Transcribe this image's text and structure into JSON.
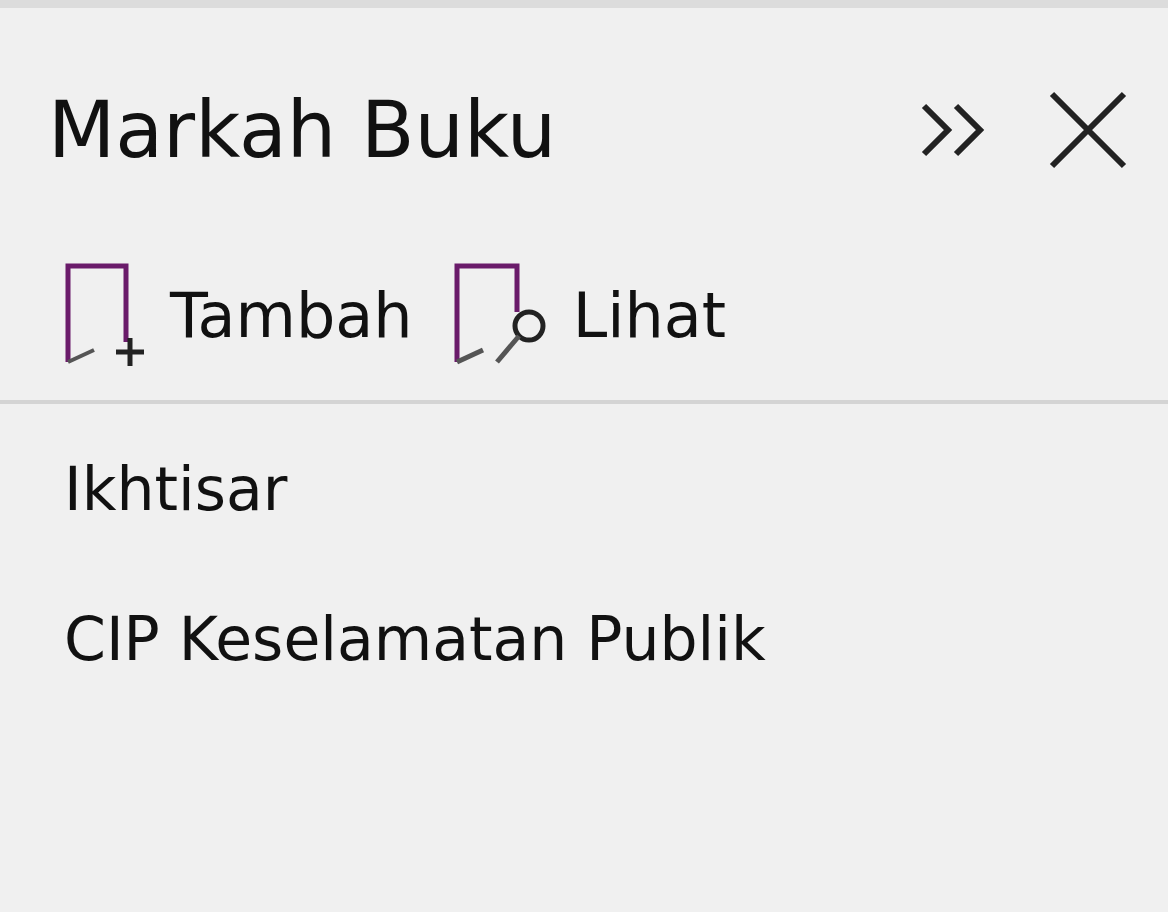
{
  "pane": {
    "title": "Markah Buku"
  },
  "toolbar": [
    {
      "label": "Tambah",
      "kind": "add"
    },
    {
      "label": "Lihat",
      "kind": "view"
    }
  ],
  "bookmarks": [
    {
      "label": "Ikhtisar"
    },
    {
      "label": "CIP Keselamatan Publik"
    }
  ]
}
